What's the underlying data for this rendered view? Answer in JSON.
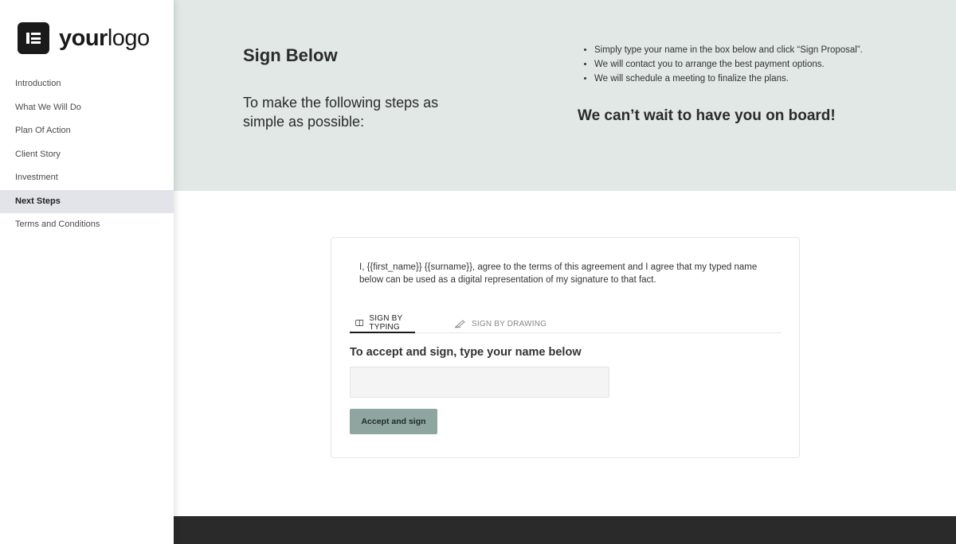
{
  "logo": {
    "prefix": "your",
    "suffix": "logo"
  },
  "nav": {
    "items": [
      {
        "label": "Introduction"
      },
      {
        "label": "What We Will Do"
      },
      {
        "label": "Plan Of Action"
      },
      {
        "label": "Client Story"
      },
      {
        "label": "Investment"
      },
      {
        "label": "Next Steps"
      },
      {
        "label": "Terms and Conditions"
      }
    ],
    "active": "Next Steps"
  },
  "hero": {
    "title": "Sign Below",
    "subtitle": "To make the following steps as simple as possible:",
    "bullets": [
      "Simply type your name in the box below and click “Sign Proposal”.",
      "We will contact you to arrange the best payment options.",
      "We will schedule a meeting to finalize the plans."
    ],
    "tagline": "We can’t wait to have you on board!"
  },
  "signature": {
    "agreement": "I, {{first_name}} {{surname}}, agree to the terms of this agreement and I agree that my typed name below can be used as a digital representation of my signature to that fact.",
    "tabs": {
      "typing": "SIGN BY TYPING",
      "drawing": "SIGN BY DRAWING"
    },
    "input_label": "To accept and sign, type your name below",
    "input_value": "",
    "input_placeholder": "",
    "button_label": "Accept and sign"
  },
  "colors": {
    "hero_bg": "#e1e8e6",
    "active_nav_bg": "#e3e4ea",
    "button_bg": "#8fa59f",
    "footer_bg": "#2a2a2a"
  }
}
